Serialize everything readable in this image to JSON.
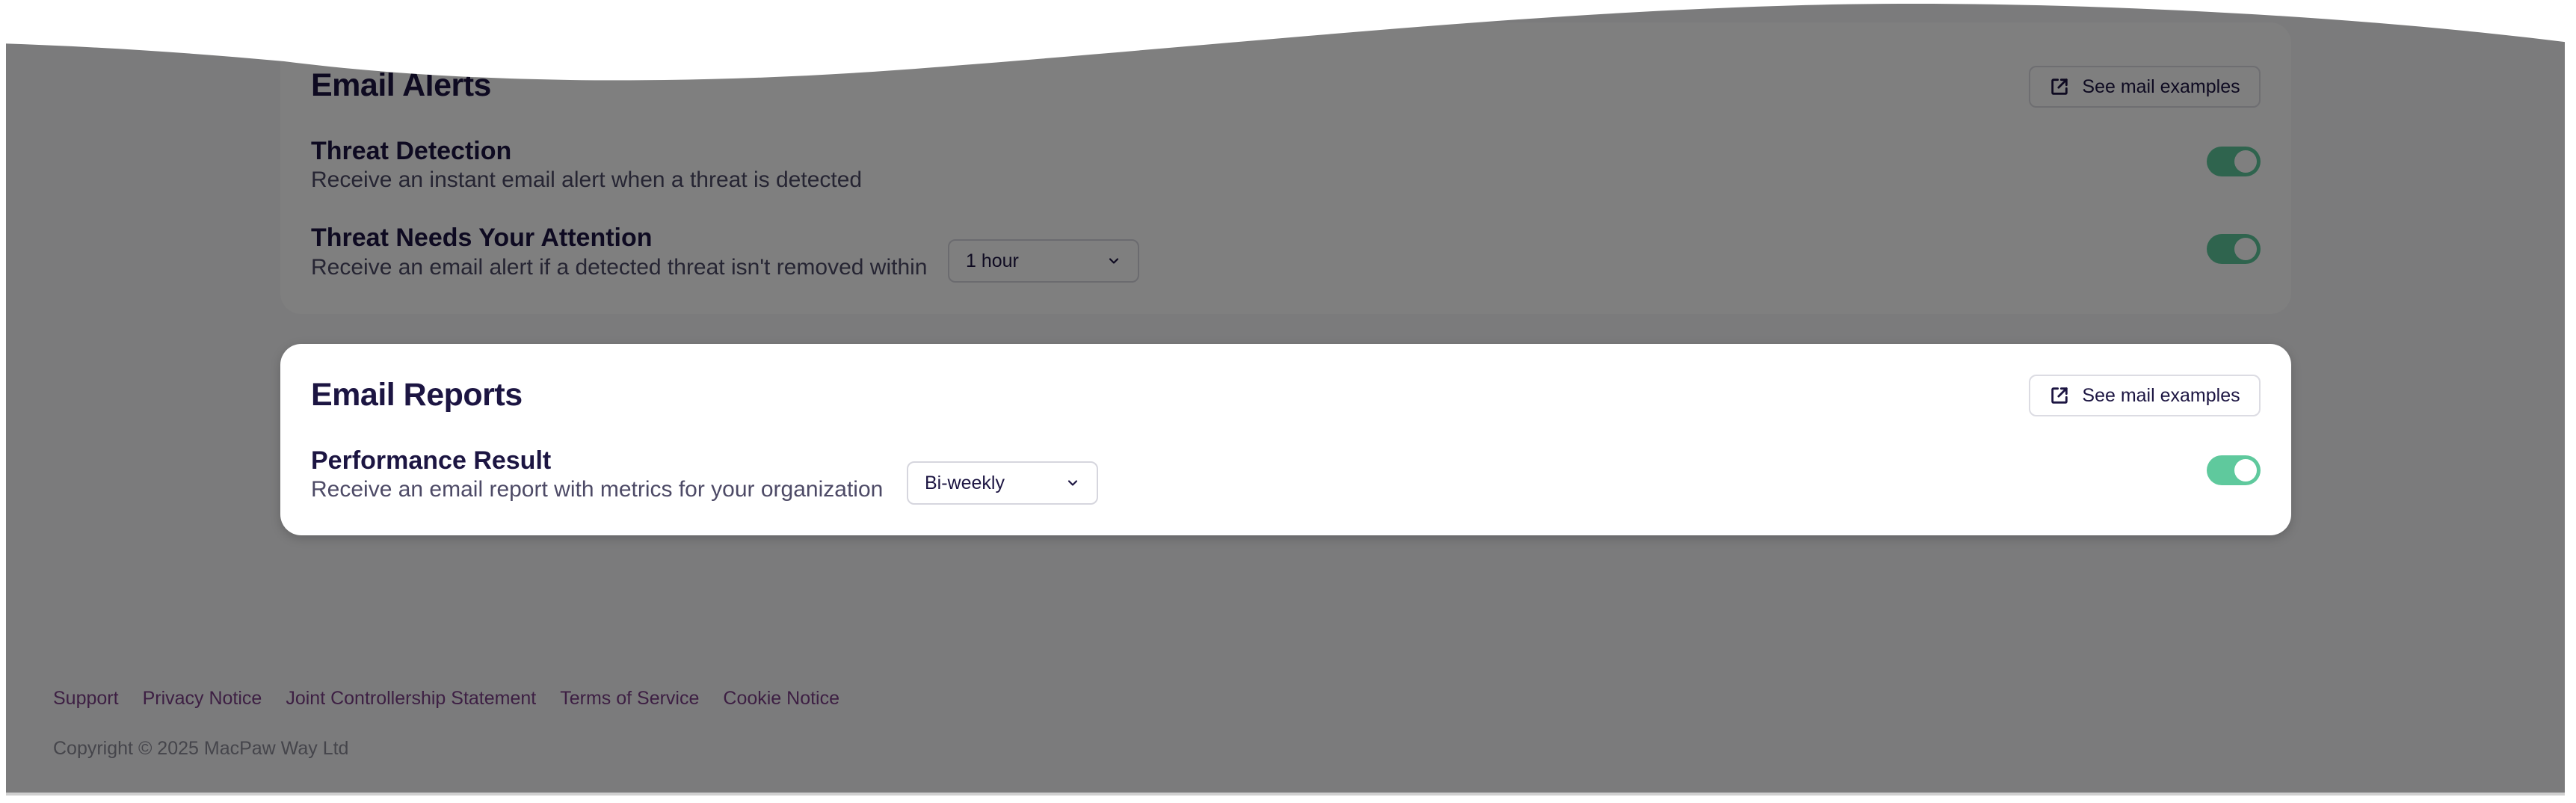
{
  "email_alerts": {
    "title": "Email Alerts",
    "examples_label": "See mail examples",
    "rows": [
      {
        "title": "Threat Detection",
        "description": "Receive an instant email alert when a threat is detected",
        "enabled": true
      },
      {
        "title": "Threat Needs Your Attention",
        "description": "Receive an email alert if a detected threat isn't removed within",
        "dropdown_value": "1 hour",
        "enabled": true
      }
    ]
  },
  "email_reports": {
    "title": "Email Reports",
    "examples_label": "See mail examples",
    "rows": [
      {
        "title": "Performance Result",
        "description": "Receive an email report with metrics for your organization",
        "dropdown_value": "Bi-weekly",
        "enabled": true
      }
    ]
  },
  "footer": {
    "links": [
      "Support",
      "Privacy Notice",
      "Joint Controllership Statement",
      "Terms of Service",
      "Cookie Notice"
    ],
    "copyright": "Copyright © 2025 MacPaw Way Ltd"
  },
  "colors": {
    "toggle_on": "#5fc99d",
    "title_text": "#1c1542",
    "link_text": "#7a3e86",
    "overlay": "rgba(0,0,0,0.5)"
  }
}
